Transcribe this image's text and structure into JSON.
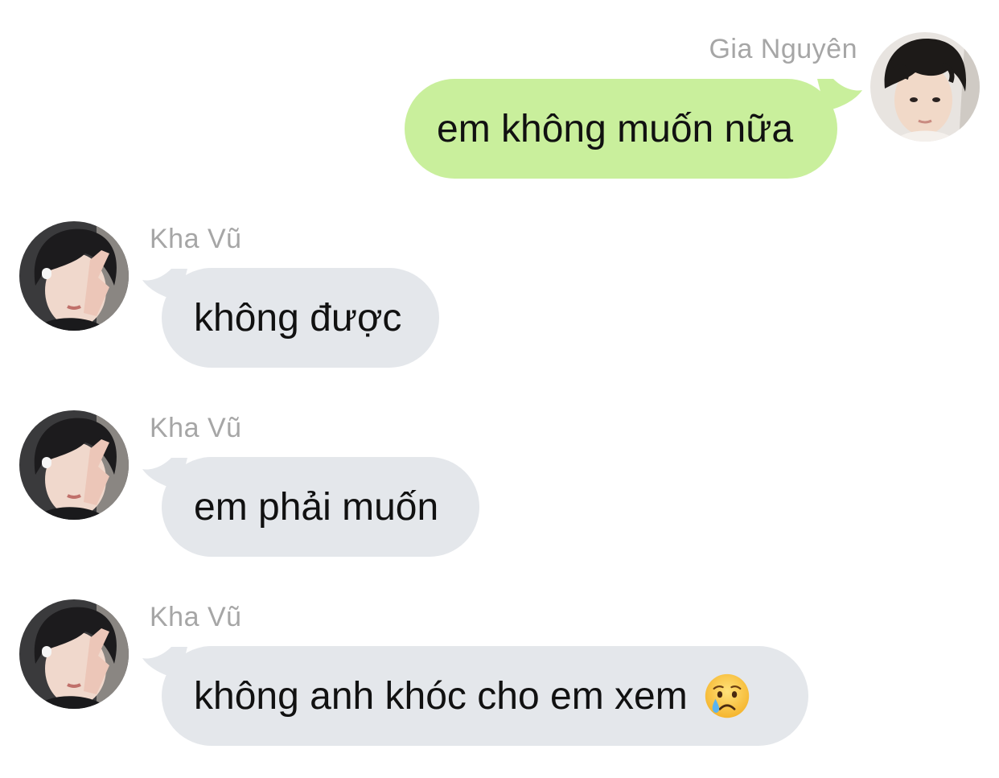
{
  "messages": [
    {
      "sender": "Gia Nguyên",
      "text": "em không muốn nữa",
      "direction": "outgoing",
      "bubble_color": "#c9ef9c"
    },
    {
      "sender": "Kha Vũ",
      "text": "không được",
      "direction": "incoming",
      "bubble_color": "#e4e7eb"
    },
    {
      "sender": "Kha Vũ",
      "text": "em phải muốn",
      "direction": "incoming",
      "bubble_color": "#e4e7eb"
    },
    {
      "sender": "Kha Vũ",
      "text": "không anh khóc cho em xem",
      "emoji": "crying-face-emoji",
      "direction": "incoming",
      "bubble_color": "#e4e7eb"
    }
  ],
  "colors": {
    "name_text": "#a6a6a6",
    "message_text": "#111111",
    "background": "#ffffff"
  }
}
